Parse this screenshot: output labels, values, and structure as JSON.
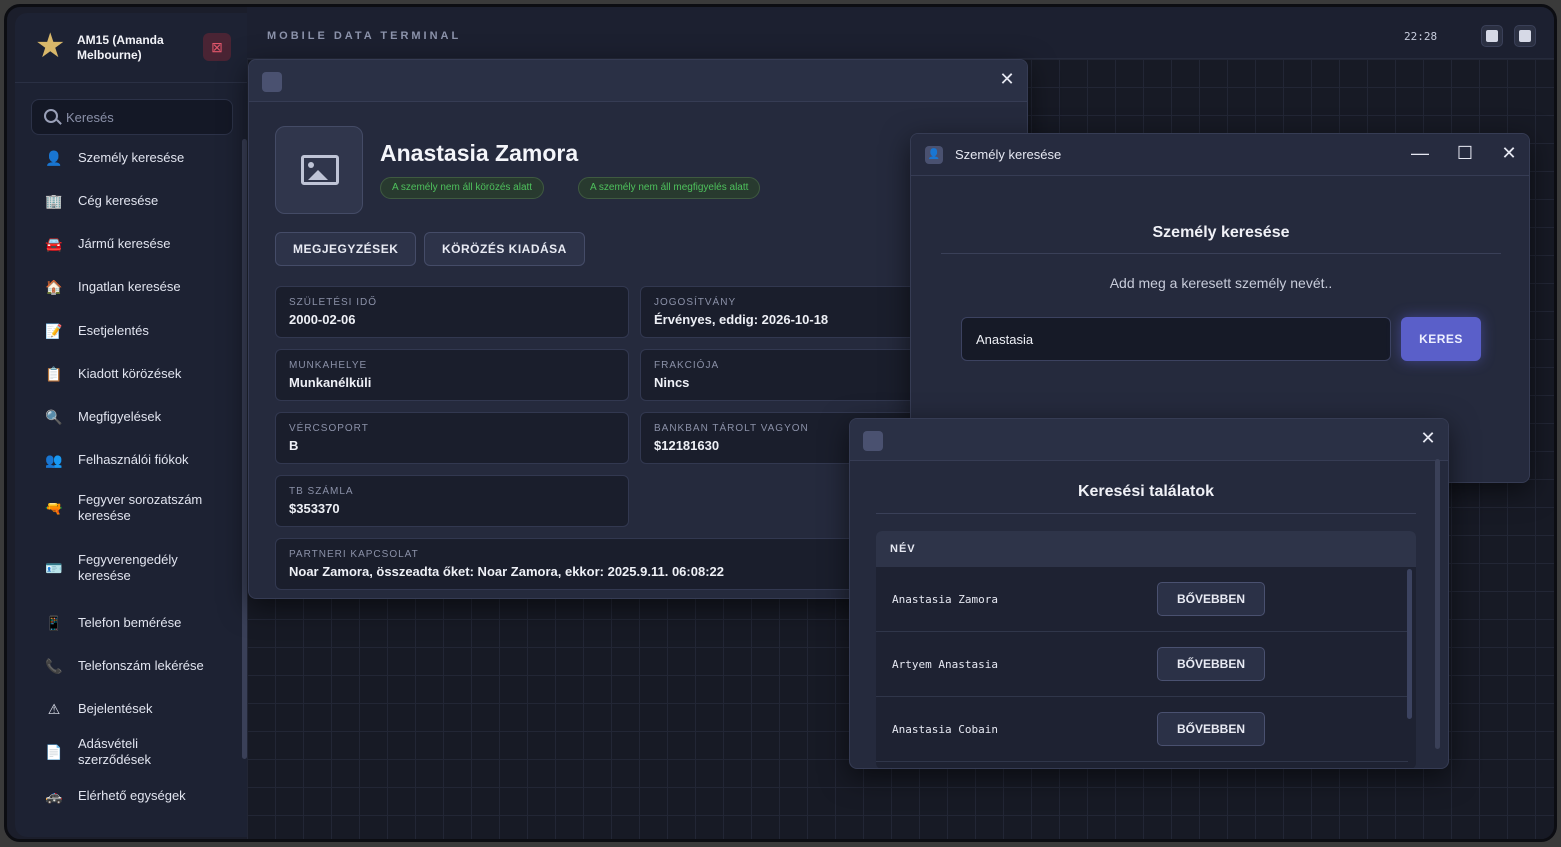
{
  "user": {
    "name": "AM15 (Amanda Melbourne)"
  },
  "sidebar": {
    "search_placeholder": "Keresés",
    "items": [
      {
        "label": "Személy keresése",
        "icon": "person-icon",
        "glyph": "👤"
      },
      {
        "label": "Cég keresése",
        "icon": "building-icon",
        "glyph": "🏢"
      },
      {
        "label": "Jármű keresése",
        "icon": "car-icon",
        "glyph": "🚘"
      },
      {
        "label": "Ingatlan keresése",
        "icon": "house-icon",
        "glyph": "🏠"
      },
      {
        "label": "Esetjelentés",
        "icon": "report-icon",
        "glyph": "📝"
      },
      {
        "label": "Kiadott körözések",
        "icon": "wanted-icon",
        "glyph": "📋"
      },
      {
        "label": "Megfigyelések",
        "icon": "magnifier-icon",
        "glyph": "🔍"
      },
      {
        "label": "Felhasználói fiókok",
        "icon": "users-icon",
        "glyph": "👥"
      },
      {
        "label": "Fegyver sorozatszám keresése",
        "icon": "gun-icon",
        "glyph": "🔫"
      },
      {
        "label": "Fegyverengedély keresése",
        "icon": "license-icon",
        "glyph": "🪪"
      },
      {
        "label": "Telefon bemérése",
        "icon": "phone-icon",
        "glyph": "📱"
      },
      {
        "label": "Telefonszám lekérése",
        "icon": "phone-number-icon",
        "glyph": "📞"
      },
      {
        "label": "Bejelentések",
        "icon": "warning-icon",
        "glyph": "⚠"
      },
      {
        "label": "Adásvételi szerződések",
        "icon": "contract-icon",
        "glyph": "📄"
      },
      {
        "label": "Elérhető egységek",
        "icon": "units-icon",
        "glyph": "🚓"
      }
    ]
  },
  "topbar": {
    "title": "MOBILE DATA TERMINAL",
    "clock": "22:28"
  },
  "profile": {
    "name": "Anastasia Zamora",
    "badges": [
      "A személy nem áll körözés alatt",
      "A személy nem áll megfigyelés alatt"
    ],
    "buttons": {
      "notes": "MEGJEGYZÉSEK",
      "issue_warrant": "KÖRÖZÉS KIADÁSA"
    },
    "fields": {
      "birth": {
        "label": "SZÜLETÉSI IDŐ",
        "value": "2000-02-06"
      },
      "license": {
        "label": "JOGOSÍTVÁNY",
        "value": "Érvényes, eddig: 2026-10-18"
      },
      "workplace": {
        "label": "MUNKAHELYE",
        "value": "Munkanélküli"
      },
      "faction": {
        "label": "FRAKCIÓJA",
        "value": "Nincs"
      },
      "blood": {
        "label": "VÉRCSOPORT",
        "value": "B"
      },
      "bank": {
        "label": "BANKBAN TÁROLT VAGYON",
        "value": "$12181630"
      },
      "tb": {
        "label": "TB SZÁMLA",
        "value": "$353370"
      },
      "partner": {
        "label": "PARTNERI KAPCSOLAT",
        "value": "Noar Zamora, összeadta őket: Noar Zamora, ekkor: 2025.9.11. 06:08:22"
      }
    }
  },
  "person_search": {
    "window_title": "Személy keresése",
    "heading": "Személy keresése",
    "description": "Add meg a keresett személy nevét..",
    "input_value": "Anastasia",
    "button": "KERES"
  },
  "results": {
    "heading": "Keresési találatok",
    "column": "NÉV",
    "more_label": "BŐVEBBEN",
    "rows": [
      "Anastasia Zamora",
      "Artyem Anastasia",
      "Anastasia Cobain"
    ]
  },
  "colors": {
    "accent": "#5a5fc9",
    "badge_green": "#4ec05c",
    "logout_red": "#e0566a"
  }
}
